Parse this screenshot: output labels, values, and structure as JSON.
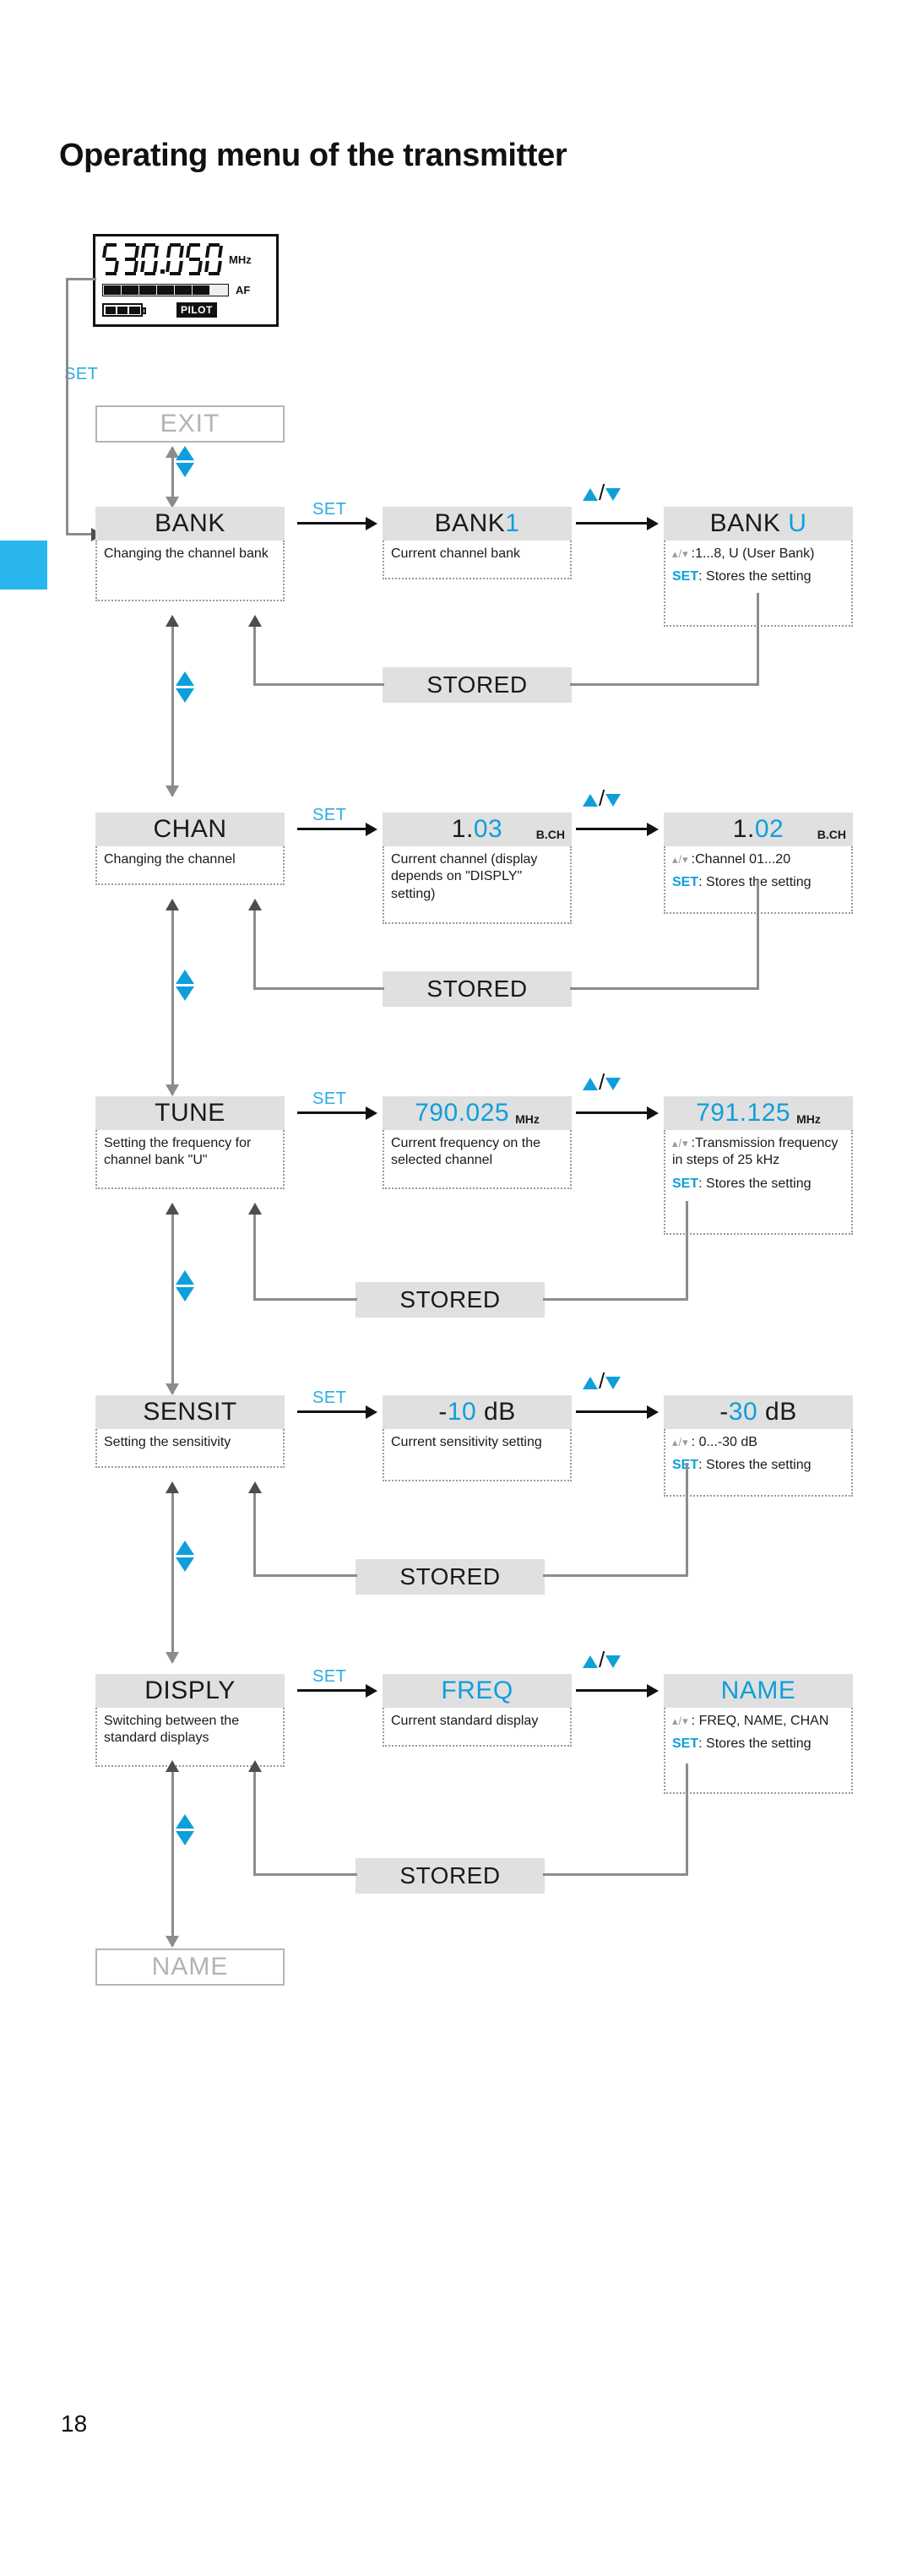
{
  "page": {
    "title": "Operating menu of the transmitter",
    "number": "18"
  },
  "lcd": {
    "frequency": "530.050",
    "frequency_unit": "MHz",
    "af_label": "AF",
    "af_segments_lit": 6,
    "af_segments_total": 7,
    "battery_cells_lit": 3,
    "battery_cells_total": 4,
    "pilot_label": "PILOT"
  },
  "entry": {
    "set_label": "SET"
  },
  "exit_node": {
    "label": "EXIT"
  },
  "name_node": {
    "label": "NAME"
  },
  "stored_label": "STORED",
  "keys": {
    "set": "SET",
    "updown_slash": "/"
  },
  "rows": [
    {
      "id": "bank",
      "menu": {
        "title": "BANK",
        "desc": "Changing the channel bank"
      },
      "value": {
        "title": "BANK",
        "highlight": "1",
        "desc": "Current channel bank"
      },
      "edit": {
        "title": "BANK",
        "highlight": "U",
        "range_separator": ":",
        "range": "1...8, U (User Bank)",
        "set_kw": "SET",
        "set_text": ": Stores the setting"
      },
      "stored": "STORED"
    },
    {
      "id": "chan",
      "menu": {
        "title": "CHAN",
        "desc": "Changing the channel"
      },
      "value": {
        "title": "1.",
        "highlight": "03",
        "sub": "B.CH",
        "desc": "Current channel (display depends on \"DISPLY\" setting)"
      },
      "edit": {
        "title": "1.",
        "highlight": "02",
        "sub": "B.CH",
        "range_separator": ":",
        "range": "Channel  01...20",
        "set_kw": "SET",
        "set_text": ": Stores the setting"
      },
      "stored": "STORED"
    },
    {
      "id": "tune",
      "menu": {
        "title": "TUNE",
        "desc": "Setting the frequency for channel bank \"U\""
      },
      "value": {
        "title": "790.025",
        "unit": "MHz",
        "desc": "Current frequency on the selected channel"
      },
      "edit": {
        "title": "791.125",
        "unit": "MHz",
        "range_separator": ":",
        "range": "Transmission frequency in steps of 25 kHz",
        "set_kw": "SET",
        "set_text": ": Stores the setting"
      },
      "stored": "STORED"
    },
    {
      "id": "sensit",
      "menu": {
        "title": "SENSIT",
        "desc": "Setting the sensitivity"
      },
      "value": {
        "title": "-",
        "highlight": "10",
        "suffix": " dB",
        "desc": "Current sensitivity setting"
      },
      "edit": {
        "title": "-",
        "highlight": "30",
        "suffix": " dB",
        "range_separator": ":",
        "range": "0...-30 dB",
        "set_kw": "SET",
        "set_text": ": Stores the setting"
      },
      "stored": "STORED"
    },
    {
      "id": "disply",
      "menu": {
        "title": "DISPLY",
        "desc": "Switching between the standard displays"
      },
      "value": {
        "title": "FREQ",
        "desc": "Current standard display"
      },
      "edit": {
        "title": "NAME",
        "range_separator": ":",
        "range": "FREQ, NAME, CHAN",
        "set_kw": "SET",
        "set_text": ": Stores the setting"
      },
      "stored": "STORED"
    }
  ],
  "colors": {
    "accent": "#0e9fdb",
    "key_blue": "#29ace3",
    "tab_blue": "#29b6ef",
    "box_grey": "#e0e0e0",
    "ghost_grey": "#b3b3b3"
  }
}
